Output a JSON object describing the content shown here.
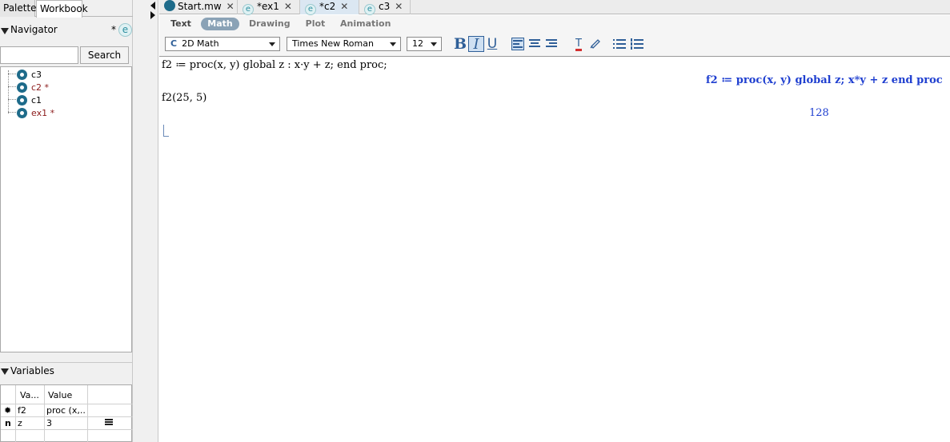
{
  "left_panel": {
    "tabs": [
      "Palettes",
      "Workbook"
    ],
    "navigator": {
      "title": "Navigator",
      "modified_marker": "*",
      "badge": "e"
    },
    "search": {
      "value": "",
      "button_label": "Search"
    },
    "tree": [
      {
        "label": "c3",
        "modified": false
      },
      {
        "label": "c2 *",
        "modified": true
      },
      {
        "label": "c1",
        "modified": false
      },
      {
        "label": "ex1 *",
        "modified": true
      }
    ],
    "variables": {
      "title": "Variables",
      "columns": [
        "Va...",
        "Value"
      ],
      "rows": [
        {
          "icon": "✹",
          "name": "f2",
          "value": "proc (x,..."
        },
        {
          "icon": "n",
          "name": "z",
          "value": "3"
        }
      ]
    }
  },
  "doc_tabs": [
    {
      "label": "Start.mw",
      "type": "mw",
      "active": false
    },
    {
      "label": "*ex1",
      "type": "e",
      "active": false
    },
    {
      "label": "*c2",
      "type": "e",
      "active": true
    },
    {
      "label": "c3",
      "type": "e",
      "active": false
    }
  ],
  "modes": [
    "Text",
    "Math",
    "Drawing",
    "Plot",
    "Animation"
  ],
  "active_mode": "Math",
  "format": {
    "style": "2D Math",
    "style_icon": "C",
    "font": "Times New Roman",
    "size": "12",
    "bold": "B",
    "italic": "I",
    "underline": "U"
  },
  "worksheet": {
    "input1": "f2 ≔ proc(x, y) global z : x·y + z; end proc;",
    "output1": "f2 ≔ proc(x, y) global z; x*y + z end proc",
    "input2": "f2(25, 5)",
    "output2": "128"
  },
  "colors": {
    "output": "#1f3fd0",
    "accent": "#2f5f98",
    "math_pill": "#8aa2b6"
  }
}
